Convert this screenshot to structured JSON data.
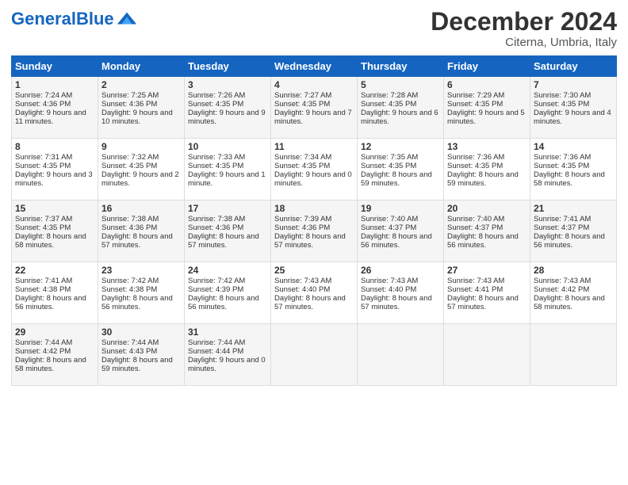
{
  "header": {
    "logo_general": "General",
    "logo_blue": "Blue",
    "title": "December 2024",
    "location": "Citerna, Umbria, Italy"
  },
  "days_of_week": [
    "Sunday",
    "Monday",
    "Tuesday",
    "Wednesday",
    "Thursday",
    "Friday",
    "Saturday"
  ],
  "weeks": [
    [
      {
        "day": "1",
        "sunrise": "7:24 AM",
        "sunset": "4:36 PM",
        "daylight": "9 hours and 11 minutes."
      },
      {
        "day": "2",
        "sunrise": "7:25 AM",
        "sunset": "4:36 PM",
        "daylight": "9 hours and 10 minutes."
      },
      {
        "day": "3",
        "sunrise": "7:26 AM",
        "sunset": "4:35 PM",
        "daylight": "9 hours and 9 minutes."
      },
      {
        "day": "4",
        "sunrise": "7:27 AM",
        "sunset": "4:35 PM",
        "daylight": "9 hours and 7 minutes."
      },
      {
        "day": "5",
        "sunrise": "7:28 AM",
        "sunset": "4:35 PM",
        "daylight": "9 hours and 6 minutes."
      },
      {
        "day": "6",
        "sunrise": "7:29 AM",
        "sunset": "4:35 PM",
        "daylight": "9 hours and 5 minutes."
      },
      {
        "day": "7",
        "sunrise": "7:30 AM",
        "sunset": "4:35 PM",
        "daylight": "9 hours and 4 minutes."
      }
    ],
    [
      {
        "day": "8",
        "sunrise": "7:31 AM",
        "sunset": "4:35 PM",
        "daylight": "9 hours and 3 minutes."
      },
      {
        "day": "9",
        "sunrise": "7:32 AM",
        "sunset": "4:35 PM",
        "daylight": "9 hours and 2 minutes."
      },
      {
        "day": "10",
        "sunrise": "7:33 AM",
        "sunset": "4:35 PM",
        "daylight": "9 hours and 1 minute."
      },
      {
        "day": "11",
        "sunrise": "7:34 AM",
        "sunset": "4:35 PM",
        "daylight": "9 hours and 0 minutes."
      },
      {
        "day": "12",
        "sunrise": "7:35 AM",
        "sunset": "4:35 PM",
        "daylight": "8 hours and 59 minutes."
      },
      {
        "day": "13",
        "sunrise": "7:36 AM",
        "sunset": "4:35 PM",
        "daylight": "8 hours and 59 minutes."
      },
      {
        "day": "14",
        "sunrise": "7:36 AM",
        "sunset": "4:35 PM",
        "daylight": "8 hours and 58 minutes."
      }
    ],
    [
      {
        "day": "15",
        "sunrise": "7:37 AM",
        "sunset": "4:35 PM",
        "daylight": "8 hours and 58 minutes."
      },
      {
        "day": "16",
        "sunrise": "7:38 AM",
        "sunset": "4:36 PM",
        "daylight": "8 hours and 57 minutes."
      },
      {
        "day": "17",
        "sunrise": "7:38 AM",
        "sunset": "4:36 PM",
        "daylight": "8 hours and 57 minutes."
      },
      {
        "day": "18",
        "sunrise": "7:39 AM",
        "sunset": "4:36 PM",
        "daylight": "8 hours and 57 minutes."
      },
      {
        "day": "19",
        "sunrise": "7:40 AM",
        "sunset": "4:37 PM",
        "daylight": "8 hours and 56 minutes."
      },
      {
        "day": "20",
        "sunrise": "7:40 AM",
        "sunset": "4:37 PM",
        "daylight": "8 hours and 56 minutes."
      },
      {
        "day": "21",
        "sunrise": "7:41 AM",
        "sunset": "4:37 PM",
        "daylight": "8 hours and 56 minutes."
      }
    ],
    [
      {
        "day": "22",
        "sunrise": "7:41 AM",
        "sunset": "4:38 PM",
        "daylight": "8 hours and 56 minutes."
      },
      {
        "day": "23",
        "sunrise": "7:42 AM",
        "sunset": "4:38 PM",
        "daylight": "8 hours and 56 minutes."
      },
      {
        "day": "24",
        "sunrise": "7:42 AM",
        "sunset": "4:39 PM",
        "daylight": "8 hours and 56 minutes."
      },
      {
        "day": "25",
        "sunrise": "7:43 AM",
        "sunset": "4:40 PM",
        "daylight": "8 hours and 57 minutes."
      },
      {
        "day": "26",
        "sunrise": "7:43 AM",
        "sunset": "4:40 PM",
        "daylight": "8 hours and 57 minutes."
      },
      {
        "day": "27",
        "sunrise": "7:43 AM",
        "sunset": "4:41 PM",
        "daylight": "8 hours and 57 minutes."
      },
      {
        "day": "28",
        "sunrise": "7:43 AM",
        "sunset": "4:42 PM",
        "daylight": "8 hours and 58 minutes."
      }
    ],
    [
      {
        "day": "29",
        "sunrise": "7:44 AM",
        "sunset": "4:42 PM",
        "daylight": "8 hours and 58 minutes."
      },
      {
        "day": "30",
        "sunrise": "7:44 AM",
        "sunset": "4:43 PM",
        "daylight": "8 hours and 59 minutes."
      },
      {
        "day": "31",
        "sunrise": "7:44 AM",
        "sunset": "4:44 PM",
        "daylight": "9 hours and 0 minutes."
      },
      null,
      null,
      null,
      null
    ]
  ]
}
